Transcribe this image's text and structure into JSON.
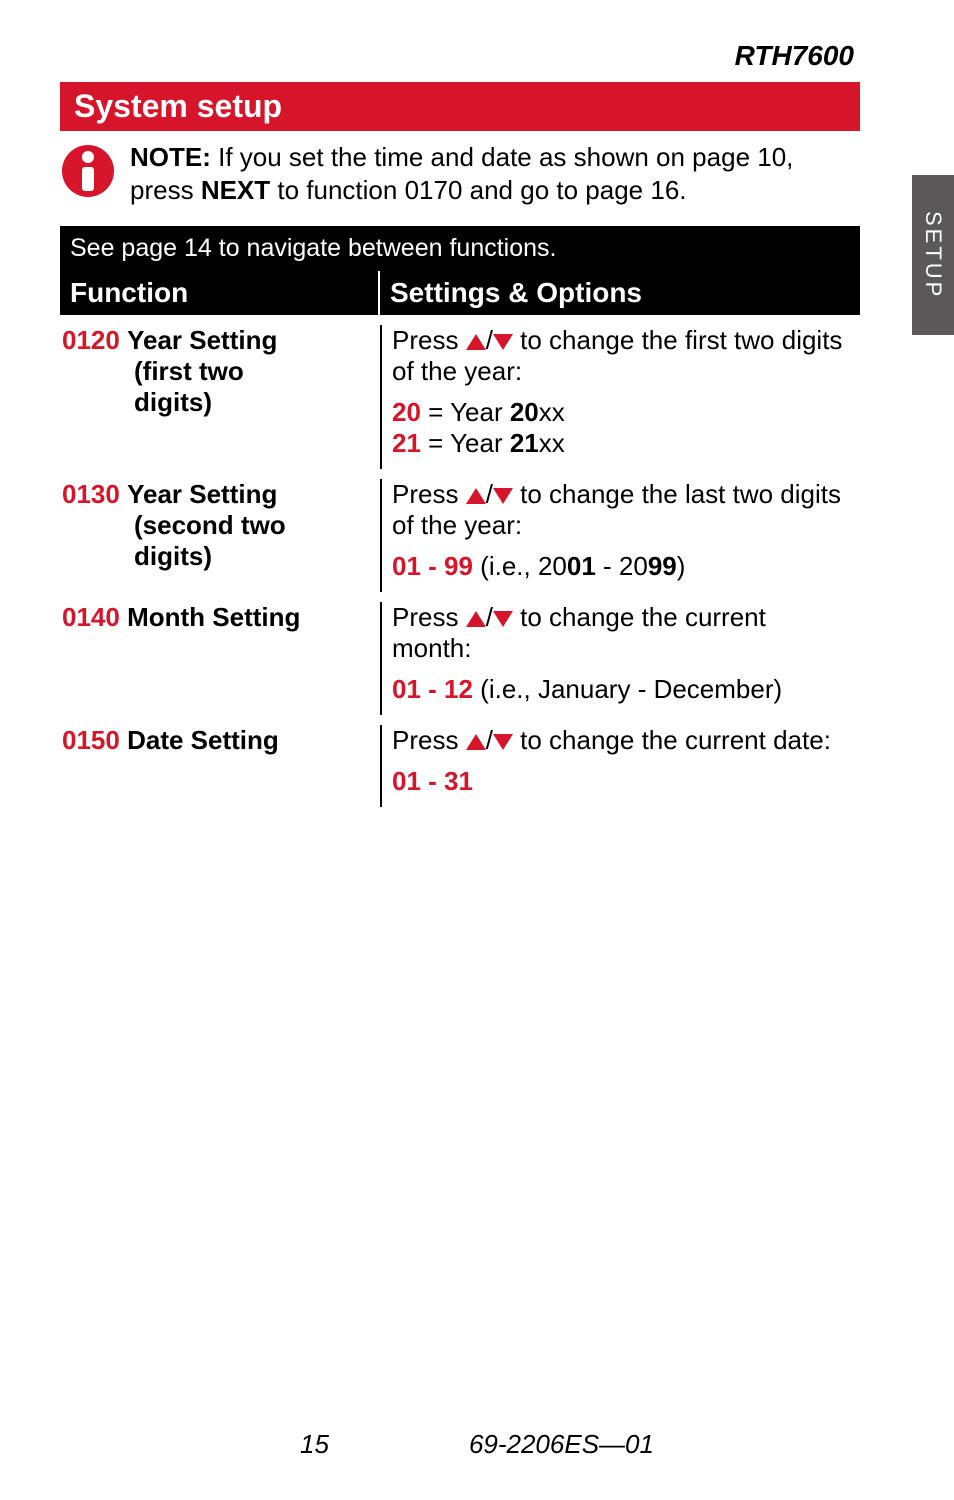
{
  "model": "RTH7600",
  "section_title": "System setup",
  "note": {
    "label": "NOTE:",
    "text1": " If you set the time and date as shown on page 10, press ",
    "next": "NEXT",
    "text2": " to function 0170 and go to page 16."
  },
  "side_tab": "SETUP",
  "nav_note": "See page 14 to navigate between functions.",
  "headers": {
    "function": "Function",
    "options": "Settings & Options"
  },
  "rows": [
    {
      "code": "0120",
      "name_line1": "Year Setting",
      "name_line2": "(first two",
      "name_line3": "digits)",
      "opt_lead": "Press ",
      "opt_tail": " to change the first two digits of the year:",
      "vals": [
        {
          "red1": "20",
          "mid": " = Year ",
          "bold": "20",
          "suffix": "xx"
        },
        {
          "red1": "21",
          "mid": " = Year ",
          "bold": "21",
          "suffix": "xx"
        }
      ]
    },
    {
      "code": "0130",
      "name_line1": "Year Setting",
      "name_line2": "(second two",
      "name_line3": "digits)",
      "opt_lead": "Press ",
      "opt_tail": " to change the last two digits of the year:",
      "range": {
        "a": "01",
        "dash": " - ",
        "b": "99",
        "extra_pre": " (i.e., 20",
        "extra_mid": "01",
        "extra_mid2": " - 20",
        "extra_end": "99",
        "extra_close": ")"
      }
    },
    {
      "code": "0140",
      "name_line1": "Month Setting",
      "opt_lead": "Press ",
      "opt_tail": " to change the current month:",
      "range": {
        "a": "01",
        "dash": " - ",
        "b": "12",
        "extra_pre": " (i.e., January - December)"
      }
    },
    {
      "code": "0150",
      "name_line1": "Date Setting",
      "opt_lead": "Press ",
      "opt_tail": " to change the current date:",
      "range": {
        "a": "01",
        "dash": " - ",
        "b": "31"
      }
    }
  ],
  "footer": {
    "page": "15",
    "doc": "69-2206ES—01"
  }
}
